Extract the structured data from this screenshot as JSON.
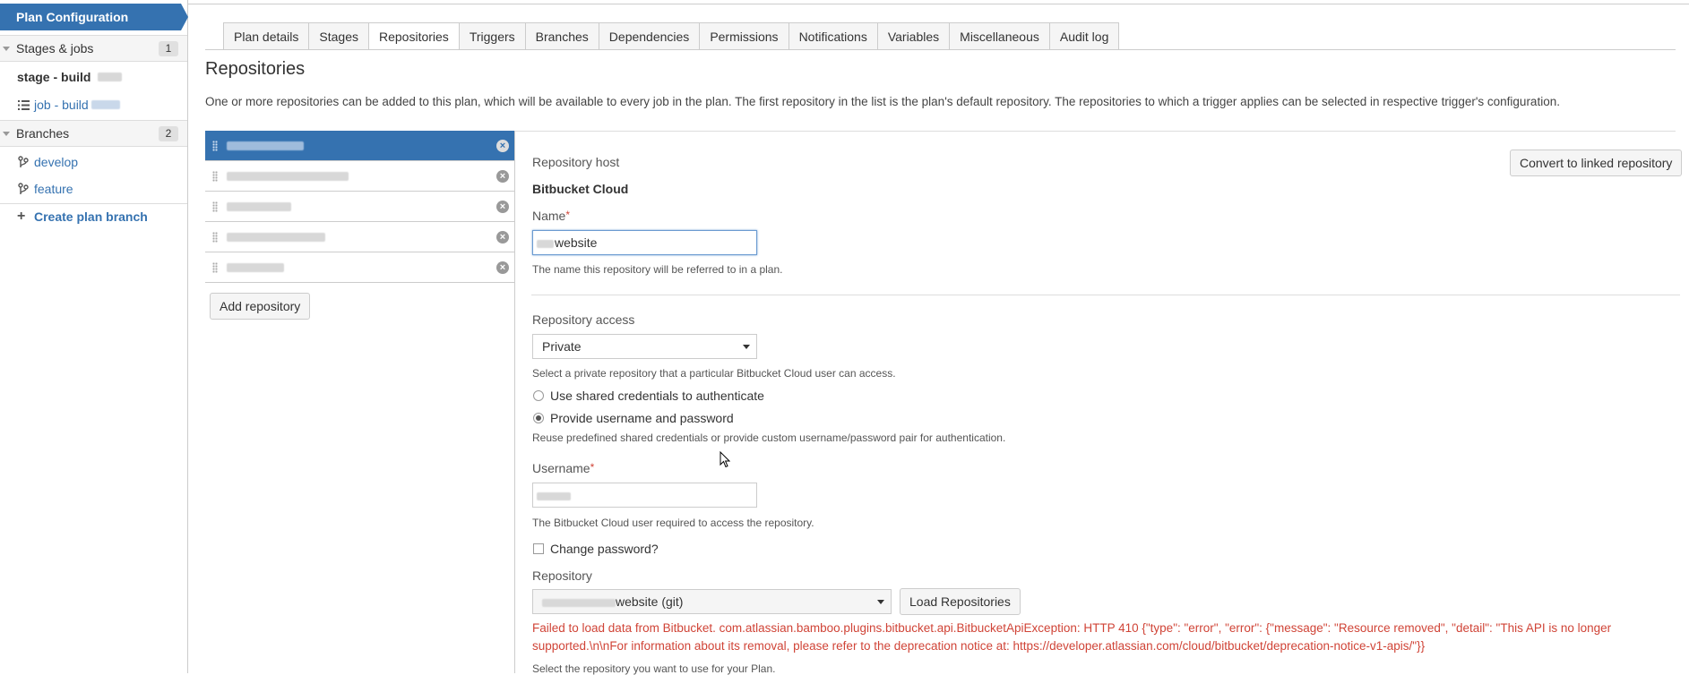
{
  "sidebar": {
    "header": "Plan Configuration",
    "stages_jobs": {
      "label": "Stages & jobs",
      "count": "1"
    },
    "stage": {
      "label": "stage - build"
    },
    "job": {
      "label": "job - build"
    },
    "branches": {
      "label": "Branches",
      "count": "2"
    },
    "branch_items": [
      {
        "label": "develop"
      },
      {
        "label": "feature"
      }
    ],
    "create_branch": "Create plan branch"
  },
  "tabs": [
    "Plan details",
    "Stages",
    "Repositories",
    "Triggers",
    "Branches",
    "Dependencies",
    "Permissions",
    "Notifications",
    "Variables",
    "Miscellaneous",
    "Audit log"
  ],
  "active_tab": "Repositories",
  "page": {
    "title": "Repositories",
    "description": "One or more repositories can be added to this plan, which will be available to every job in the plan. The first repository in the list is the plan's default repository. The repositories to which a trigger applies can be selected in respective trigger's configuration."
  },
  "repo_list": {
    "add_button": "Add repository"
  },
  "form": {
    "convert_button": "Convert to linked repository",
    "host_label": "Repository host",
    "host_value": "Bitbucket Cloud",
    "name_label": "Name",
    "name_value": "website",
    "name_help": "The name this repository will be referred to in a plan.",
    "access_label": "Repository access",
    "access_value": "Private",
    "access_help": "Select a private repository that a particular Bitbucket Cloud user can access.",
    "radio_shared": "Use shared credentials to authenticate",
    "radio_provide": "Provide username and password",
    "radio_help": "Reuse predefined shared credentials or provide custom username/password pair for authentication.",
    "username_label": "Username",
    "username_help": "The Bitbucket Cloud user required to access the repository.",
    "change_password": "Change password?",
    "repository_label": "Repository",
    "repository_value": "website (git)",
    "load_button": "Load Repositories",
    "error_line1": "Failed to load data from Bitbucket. com.atlassian.bamboo.plugins.bitbucket.api.BitbucketApiException: HTTP 410 {\"type\": \"error\", \"error\": {\"message\": \"Resource removed\", \"detail\": \"This API is no longer",
    "error_line2": "supported.\\n\\nFor information about its removal, please refer to the deprecation notice at: https://developer.atlassian.com/cloud/bitbucket/deprecation-notice-v1-apis/\"}}",
    "repository_help": "Select the repository you want to use for your Plan."
  },
  "colors": {
    "accent": "#3572b0",
    "error": "#d04437"
  }
}
